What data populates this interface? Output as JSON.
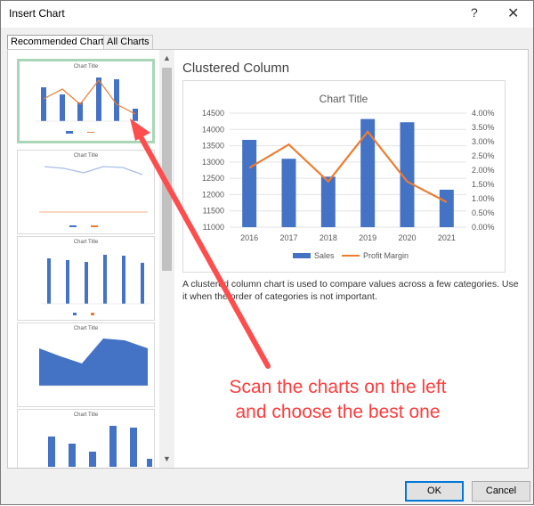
{
  "window": {
    "title": "Insert Chart",
    "help_glyph": "?",
    "close_glyph": "✕"
  },
  "tabs": [
    {
      "label": "Recommended Charts",
      "active": true
    },
    {
      "label": "All Charts",
      "active": false
    }
  ],
  "thumbnails": [
    {
      "title": "Chart Title",
      "kind": "clustered-column-line",
      "selected": true
    },
    {
      "title": "Chart Title",
      "kind": "line"
    },
    {
      "title": "Chart Title",
      "kind": "column-thin"
    },
    {
      "title": "Chart Title",
      "kind": "area"
    },
    {
      "title": "Chart Title",
      "kind": "column"
    }
  ],
  "preview": {
    "chart_type_title": "Clustered Column",
    "description": "A clustered column chart is used to compare values across a few categories. Use it when the order of categories is not important."
  },
  "chart_data": {
    "type": "bar",
    "title": "Chart Title",
    "categories": [
      "2016",
      "2017",
      "2018",
      "2019",
      "2020",
      "2021"
    ],
    "series": [
      {
        "name": "Sales",
        "kind": "bar",
        "axis": "left",
        "color": "#4472c4",
        "values": [
          13680,
          13100,
          12550,
          14320,
          14220,
          12150
        ]
      },
      {
        "name": "Profit Margin",
        "kind": "line",
        "axis": "right",
        "color": "#ed7d31",
        "values": [
          0.0208,
          0.029,
          0.016,
          0.0335,
          0.016,
          0.0088
        ]
      }
    ],
    "ylim": [
      11000,
      14500
    ],
    "yticks": [
      "14500",
      "14000",
      "13500",
      "13000",
      "12500",
      "12000",
      "11500",
      "11000"
    ],
    "y2lim": [
      0,
      0.04
    ],
    "y2ticks": [
      "4.00%",
      "3.50%",
      "3.00%",
      "2.50%",
      "2.00%",
      "1.50%",
      "1.00%",
      "0.50%",
      "0.00%"
    ],
    "grid": true,
    "legend_position": "bottom"
  },
  "annotation": {
    "text": "Scan the charts on the left and choose the best one",
    "color": "#ff3b3b"
  },
  "buttons": {
    "ok": "OK",
    "cancel": "Cancel"
  },
  "icons": {
    "scroll_up": "chevron-up-icon",
    "scroll_down": "chevron-down-icon",
    "close": "close-icon",
    "help": "help-icon"
  }
}
